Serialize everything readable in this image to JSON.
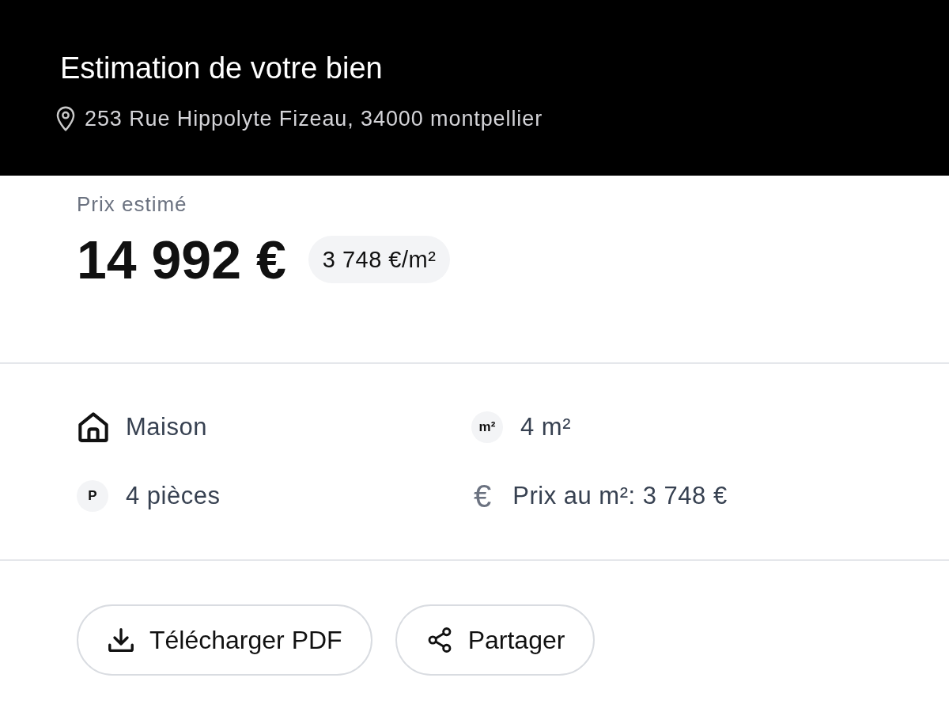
{
  "header": {
    "title": "Estimation de votre bien",
    "address": "253 Rue Hippolyte Fizeau, 34000 montpellier"
  },
  "estimate": {
    "label": "Prix estimé",
    "price": "14 992 €",
    "price_per_m2": "3 748 €/m²"
  },
  "features": [
    {
      "kind": "type",
      "label": "Maison"
    },
    {
      "kind": "area",
      "symbol": "m²",
      "label": "4 m²"
    },
    {
      "kind": "rooms",
      "symbol": "P",
      "label": "4 pièces"
    },
    {
      "kind": "unit-price",
      "symbol": "€",
      "label": "Prix au m²: 3 748 €"
    }
  ],
  "actions": [
    {
      "kind": "download",
      "label": "Télécharger PDF"
    },
    {
      "kind": "share",
      "label": "Partager"
    }
  ]
}
